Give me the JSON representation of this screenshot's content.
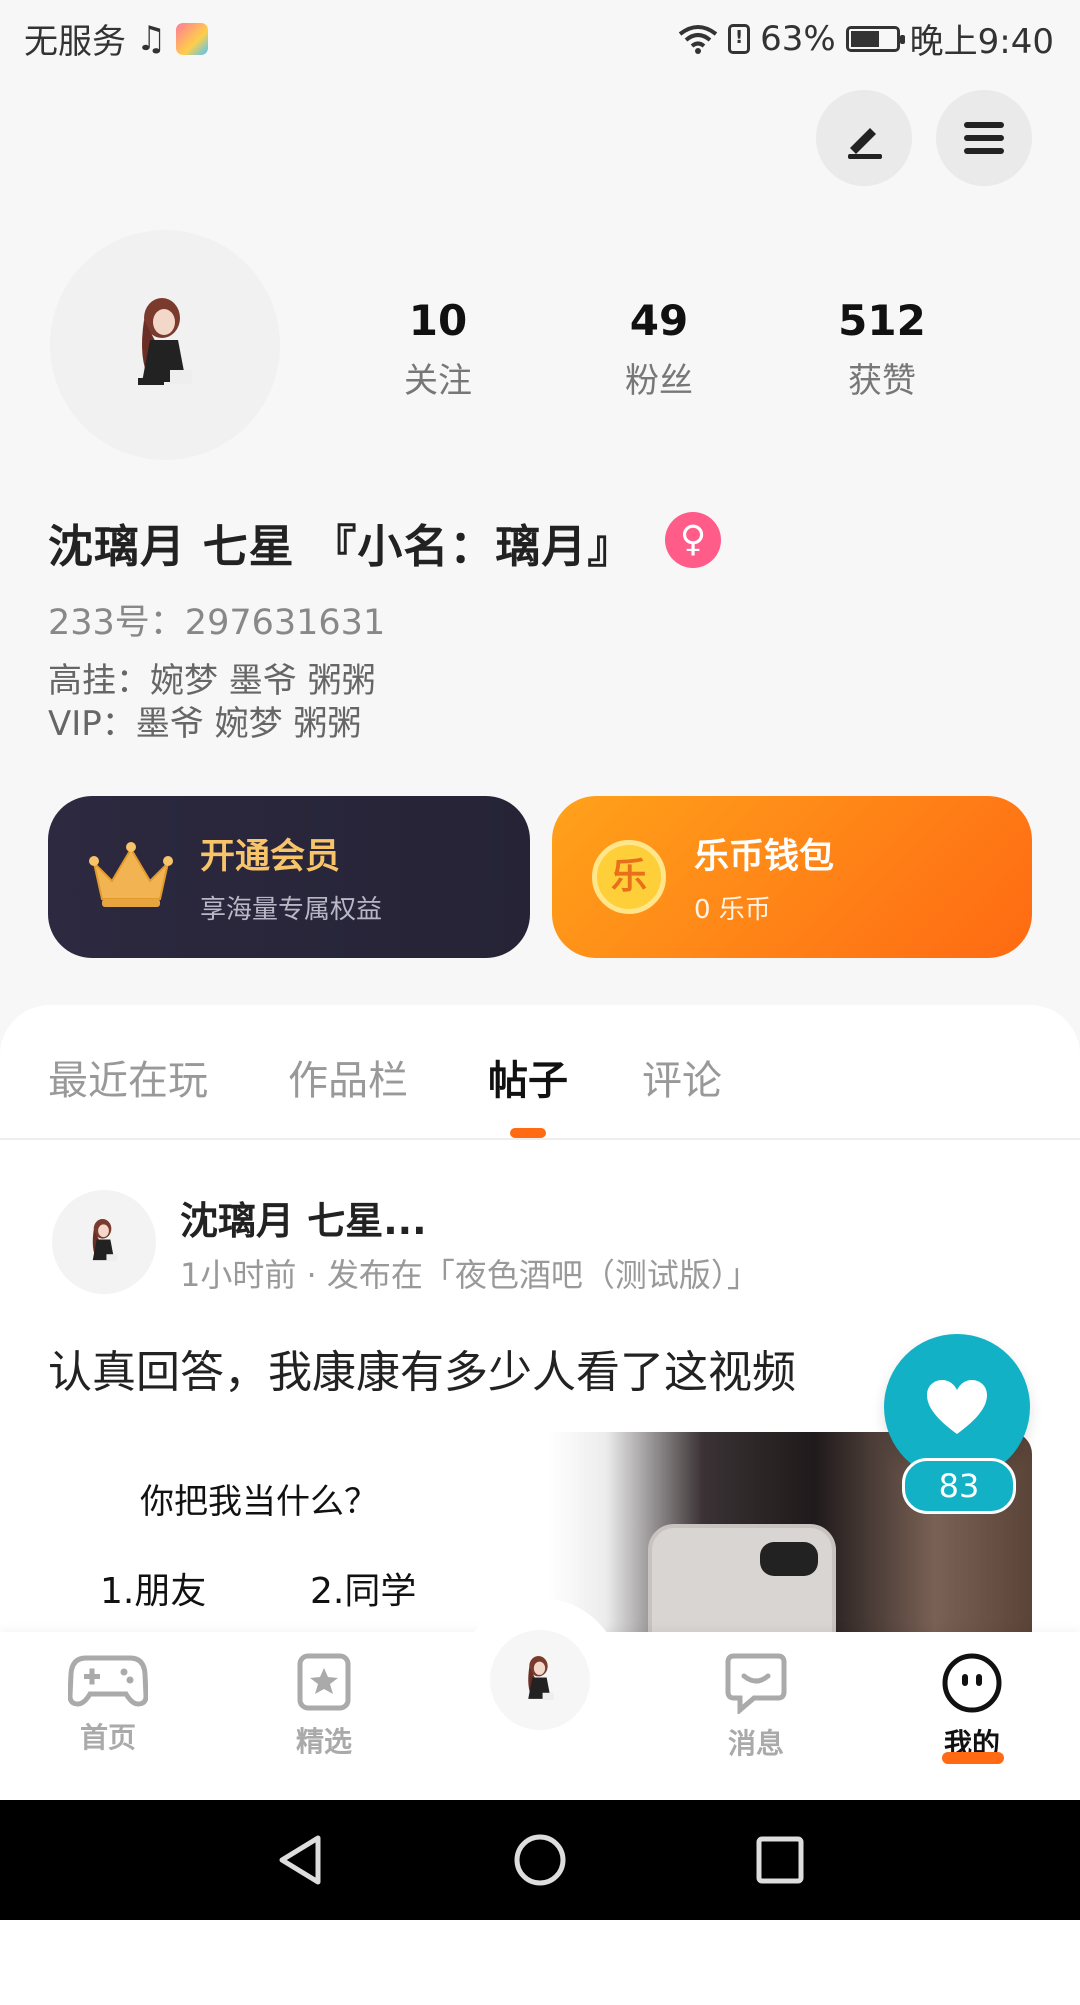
{
  "status_bar": {
    "carrier": "无服务",
    "battery": "63%",
    "battery_level": 0.63,
    "time": "晚上9:40"
  },
  "profile": {
    "stats": [
      {
        "value": "10",
        "label": "关注"
      },
      {
        "value": "49",
        "label": "粉丝"
      },
      {
        "value": "512",
        "label": "获赞"
      }
    ],
    "name": "沈璃月 七星 『小名：璃月』",
    "gender_icon": "female-icon",
    "id_line": "233号：297631631",
    "bio_lines": [
      "高挂：婉梦 墨爷 粥粥",
      "VIP：墨爷 婉梦 粥粥"
    ]
  },
  "cards": {
    "vip": {
      "title": "开通会员",
      "subtitle": "享海量专属权益"
    },
    "wallet": {
      "icon_text": "乐",
      "title": "乐币钱包",
      "subtitle": "0 乐币"
    }
  },
  "tabs": [
    {
      "label": "最近在玩",
      "active": false
    },
    {
      "label": "作品栏",
      "active": false
    },
    {
      "label": "帖子",
      "active": true
    },
    {
      "label": "评论",
      "active": false
    }
  ],
  "post": {
    "author": "沈璃月 七星...",
    "meta": "1小时前 · 发布在「夜色酒吧（测试版）」",
    "text": "认真回答，我康康有多少人看了这视频",
    "image_text": {
      "question": "你把我当什么？",
      "option1": "1.朋友",
      "option2": "2.同学"
    },
    "likes": "83"
  },
  "bottom_nav": [
    {
      "label": "首页",
      "icon": "gamepad-icon",
      "active": false
    },
    {
      "label": "精选",
      "icon": "star-bookmark-icon",
      "active": false
    },
    {
      "label": "",
      "icon": "avatar-icon",
      "active": false
    },
    {
      "label": "消息",
      "icon": "chat-icon",
      "active": false
    },
    {
      "label": "我的",
      "icon": "smiley-icon",
      "active": true
    }
  ],
  "colors": {
    "accent": "#ff6a12",
    "like": "#12b1c6",
    "vip_card": "#2a2739",
    "wallet_card": "#ff8a14",
    "vip_gold": "#f7c46a"
  }
}
